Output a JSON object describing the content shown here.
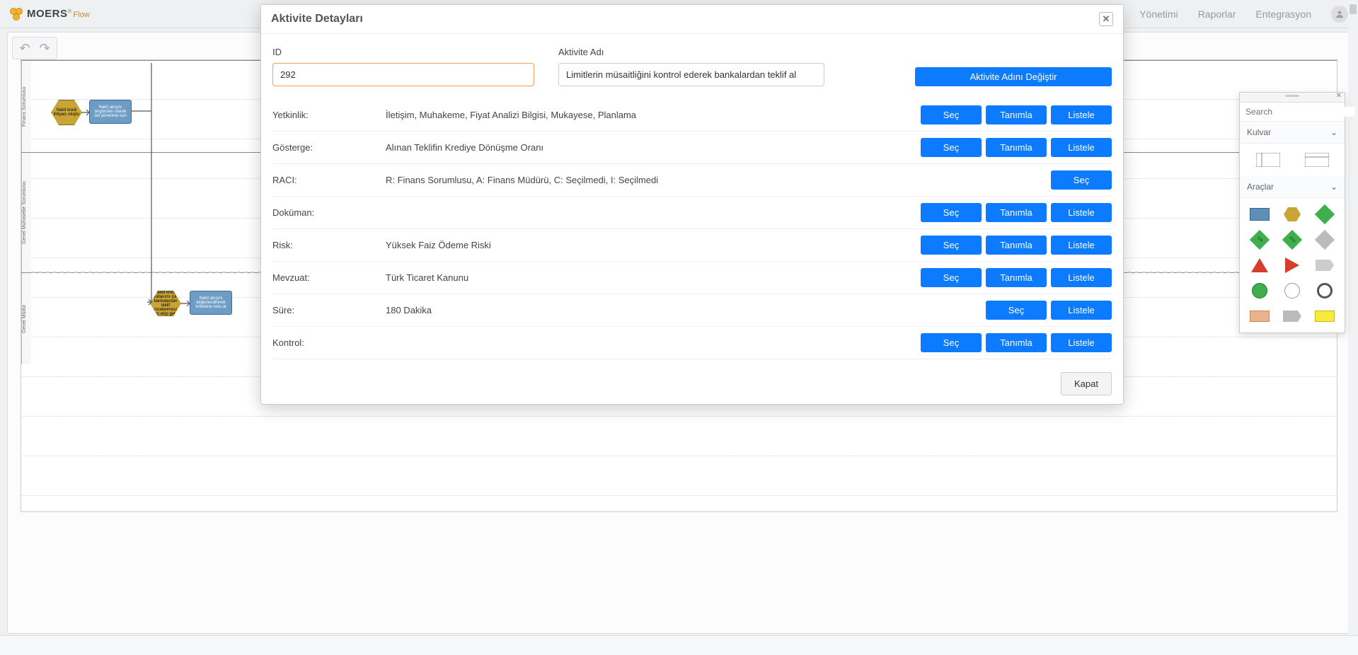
{
  "app": {
    "brand": "MOERS",
    "product": "Flow"
  },
  "nav": {
    "items": [
      "Yönetimi",
      "Raporlar",
      "Entegrasyon"
    ]
  },
  "palette": {
    "search_placeholder": "Search",
    "sections": [
      "Kulvar",
      "Araçlar"
    ]
  },
  "diagram": {
    "lanes": [
      "Finans Sorumlusu",
      "Genel Muhasebe Sorumlusu",
      "Genel Müdür"
    ],
    "nodes": {
      "n1": "Nakit kredi ihtiyacı oluştu",
      "n2": "Nakit akışını öngörülen olarak üst yönetime sun",
      "n3": "Nakit kredi kullanımı için bankalardan teklif incelenmesi için ekip geldi",
      "n4": "Nakit akışını değerlendirerek kriterlere notu al"
    }
  },
  "modal": {
    "title": "Aktivite Detayları",
    "id_label": "ID",
    "id_value": "292",
    "name_label": "Aktivite Adı",
    "name_value": "Limitlerin müsaitliğini kontrol ederek bankalardan teklif al",
    "change_name_btn": "Aktivite Adını Değiştir",
    "close_btn": "Kapat",
    "common_btns": {
      "sec": "Seç",
      "tanimla": "Tanımla",
      "listele": "Listele"
    },
    "rows": [
      {
        "label": "Yetkinlik:",
        "value": "İletişim, Muhakeme, Fiyat Analizi Bilgisi, Mukayese, Planlama",
        "btns": [
          "sec",
          "tanimla",
          "listele"
        ]
      },
      {
        "label": "Gösterge:",
        "value": "Alınan Teklifin Krediye Dönüşme Oranı",
        "btns": [
          "sec",
          "tanimla",
          "listele"
        ]
      },
      {
        "label": "RACI:",
        "value": "R: Finans Sorumlusu, A: Finans Müdürü, C: Seçilmedi, I: Seçilmedi",
        "btns": [
          "sec"
        ]
      },
      {
        "label": "Doküman:",
        "value": "",
        "btns": [
          "sec",
          "tanimla",
          "listele"
        ]
      },
      {
        "label": "Risk:",
        "value": "Yüksek Faiz Ödeme Riski",
        "btns": [
          "sec",
          "tanimla",
          "listele"
        ]
      },
      {
        "label": "Mevzuat:",
        "value": "Türk Ticaret Kanunu",
        "btns": [
          "sec",
          "tanimla",
          "listele"
        ]
      },
      {
        "label": "Süre:",
        "value": "180 Dakika",
        "btns": [
          "sec",
          "listele"
        ]
      },
      {
        "label": "Kontrol:",
        "value": "",
        "btns": [
          "sec",
          "tanimla",
          "listele"
        ]
      }
    ]
  }
}
